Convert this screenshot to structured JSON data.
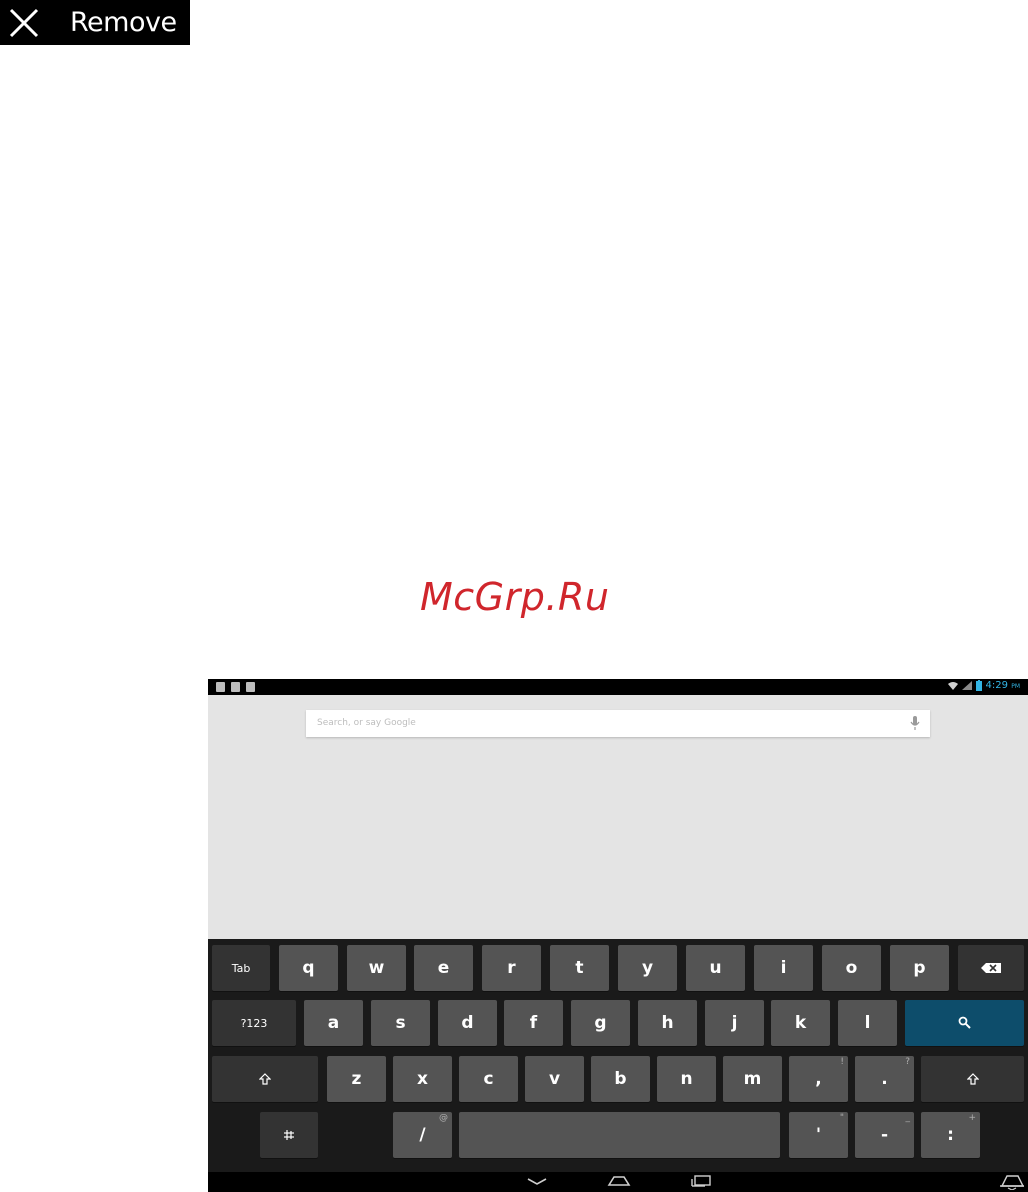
{
  "header": {
    "remove_label": "Remove"
  },
  "watermark": {
    "text": "McGrp.Ru"
  },
  "status_bar": {
    "time": "4:29",
    "ampm": "PM"
  },
  "search": {
    "placeholder": "Search, or say Google"
  },
  "keyboard": {
    "tab_label": "Tab",
    "sym_label": "?123",
    "row1": [
      "q",
      "w",
      "e",
      "r",
      "t",
      "y",
      "u",
      "i",
      "o",
      "p"
    ],
    "row2": [
      "a",
      "s",
      "d",
      "f",
      "g",
      "h",
      "j",
      "k",
      "l"
    ],
    "row3": [
      "z",
      "x",
      "c",
      "v",
      "b",
      "n",
      "m"
    ],
    "comma": ",",
    "comma_alt": "!",
    "period": ".",
    "period_alt": "?",
    "slash": "/",
    "slash_alt": "@",
    "apostrophe": "'",
    "apostrophe_alt": "\"",
    "dash": "-",
    "dash_alt": "_",
    "colon": ":",
    "colon_alt": "+"
  },
  "colors": {
    "accent": "#33b5e5",
    "key": "#545454",
    "key_dark": "#333333",
    "search_key": "#0d4d6b",
    "watermark": "#d0262c"
  },
  "icons": [
    "close-icon",
    "mic-icon",
    "backspace-icon",
    "search-icon",
    "shift-icon",
    "settings-icon",
    "nav-back-icon",
    "nav-home-icon",
    "nav-recents-icon",
    "keyboard-hide-icon"
  ]
}
